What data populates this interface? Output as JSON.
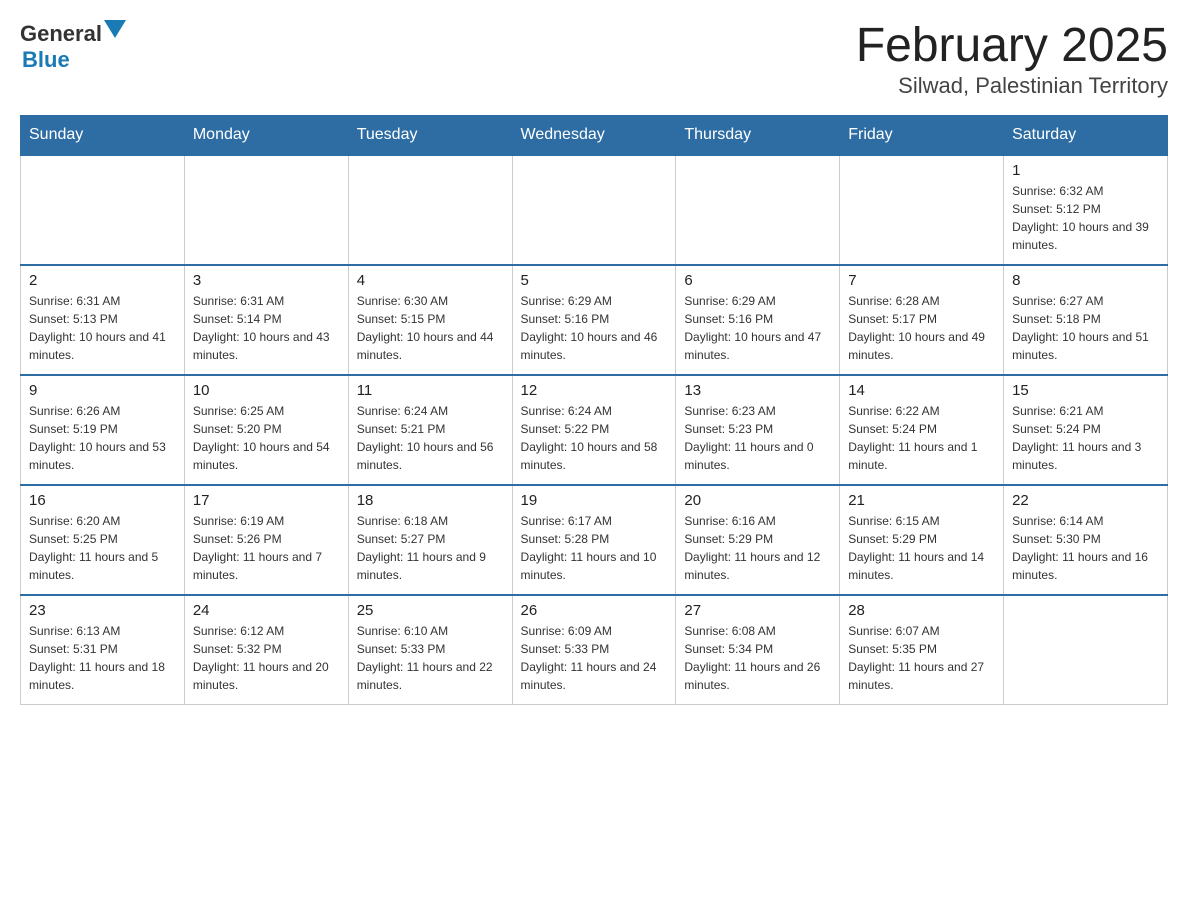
{
  "header": {
    "logo": {
      "text_general": "General",
      "text_blue": "Blue"
    },
    "title": "February 2025",
    "subtitle": "Silwad, Palestinian Territory"
  },
  "calendar": {
    "days_of_week": [
      "Sunday",
      "Monday",
      "Tuesday",
      "Wednesday",
      "Thursday",
      "Friday",
      "Saturday"
    ],
    "weeks": [
      [
        {
          "day": "",
          "info": ""
        },
        {
          "day": "",
          "info": ""
        },
        {
          "day": "",
          "info": ""
        },
        {
          "day": "",
          "info": ""
        },
        {
          "day": "",
          "info": ""
        },
        {
          "day": "",
          "info": ""
        },
        {
          "day": "1",
          "info": "Sunrise: 6:32 AM\nSunset: 5:12 PM\nDaylight: 10 hours and 39 minutes."
        }
      ],
      [
        {
          "day": "2",
          "info": "Sunrise: 6:31 AM\nSunset: 5:13 PM\nDaylight: 10 hours and 41 minutes."
        },
        {
          "day": "3",
          "info": "Sunrise: 6:31 AM\nSunset: 5:14 PM\nDaylight: 10 hours and 43 minutes."
        },
        {
          "day": "4",
          "info": "Sunrise: 6:30 AM\nSunset: 5:15 PM\nDaylight: 10 hours and 44 minutes."
        },
        {
          "day": "5",
          "info": "Sunrise: 6:29 AM\nSunset: 5:16 PM\nDaylight: 10 hours and 46 minutes."
        },
        {
          "day": "6",
          "info": "Sunrise: 6:29 AM\nSunset: 5:16 PM\nDaylight: 10 hours and 47 minutes."
        },
        {
          "day": "7",
          "info": "Sunrise: 6:28 AM\nSunset: 5:17 PM\nDaylight: 10 hours and 49 minutes."
        },
        {
          "day": "8",
          "info": "Sunrise: 6:27 AM\nSunset: 5:18 PM\nDaylight: 10 hours and 51 minutes."
        }
      ],
      [
        {
          "day": "9",
          "info": "Sunrise: 6:26 AM\nSunset: 5:19 PM\nDaylight: 10 hours and 53 minutes."
        },
        {
          "day": "10",
          "info": "Sunrise: 6:25 AM\nSunset: 5:20 PM\nDaylight: 10 hours and 54 minutes."
        },
        {
          "day": "11",
          "info": "Sunrise: 6:24 AM\nSunset: 5:21 PM\nDaylight: 10 hours and 56 minutes."
        },
        {
          "day": "12",
          "info": "Sunrise: 6:24 AM\nSunset: 5:22 PM\nDaylight: 10 hours and 58 minutes."
        },
        {
          "day": "13",
          "info": "Sunrise: 6:23 AM\nSunset: 5:23 PM\nDaylight: 11 hours and 0 minutes."
        },
        {
          "day": "14",
          "info": "Sunrise: 6:22 AM\nSunset: 5:24 PM\nDaylight: 11 hours and 1 minute."
        },
        {
          "day": "15",
          "info": "Sunrise: 6:21 AM\nSunset: 5:24 PM\nDaylight: 11 hours and 3 minutes."
        }
      ],
      [
        {
          "day": "16",
          "info": "Sunrise: 6:20 AM\nSunset: 5:25 PM\nDaylight: 11 hours and 5 minutes."
        },
        {
          "day": "17",
          "info": "Sunrise: 6:19 AM\nSunset: 5:26 PM\nDaylight: 11 hours and 7 minutes."
        },
        {
          "day": "18",
          "info": "Sunrise: 6:18 AM\nSunset: 5:27 PM\nDaylight: 11 hours and 9 minutes."
        },
        {
          "day": "19",
          "info": "Sunrise: 6:17 AM\nSunset: 5:28 PM\nDaylight: 11 hours and 10 minutes."
        },
        {
          "day": "20",
          "info": "Sunrise: 6:16 AM\nSunset: 5:29 PM\nDaylight: 11 hours and 12 minutes."
        },
        {
          "day": "21",
          "info": "Sunrise: 6:15 AM\nSunset: 5:29 PM\nDaylight: 11 hours and 14 minutes."
        },
        {
          "day": "22",
          "info": "Sunrise: 6:14 AM\nSunset: 5:30 PM\nDaylight: 11 hours and 16 minutes."
        }
      ],
      [
        {
          "day": "23",
          "info": "Sunrise: 6:13 AM\nSunset: 5:31 PM\nDaylight: 11 hours and 18 minutes."
        },
        {
          "day": "24",
          "info": "Sunrise: 6:12 AM\nSunset: 5:32 PM\nDaylight: 11 hours and 20 minutes."
        },
        {
          "day": "25",
          "info": "Sunrise: 6:10 AM\nSunset: 5:33 PM\nDaylight: 11 hours and 22 minutes."
        },
        {
          "day": "26",
          "info": "Sunrise: 6:09 AM\nSunset: 5:33 PM\nDaylight: 11 hours and 24 minutes."
        },
        {
          "day": "27",
          "info": "Sunrise: 6:08 AM\nSunset: 5:34 PM\nDaylight: 11 hours and 26 minutes."
        },
        {
          "day": "28",
          "info": "Sunrise: 6:07 AM\nSunset: 5:35 PM\nDaylight: 11 hours and 27 minutes."
        },
        {
          "day": "",
          "info": ""
        }
      ]
    ]
  }
}
